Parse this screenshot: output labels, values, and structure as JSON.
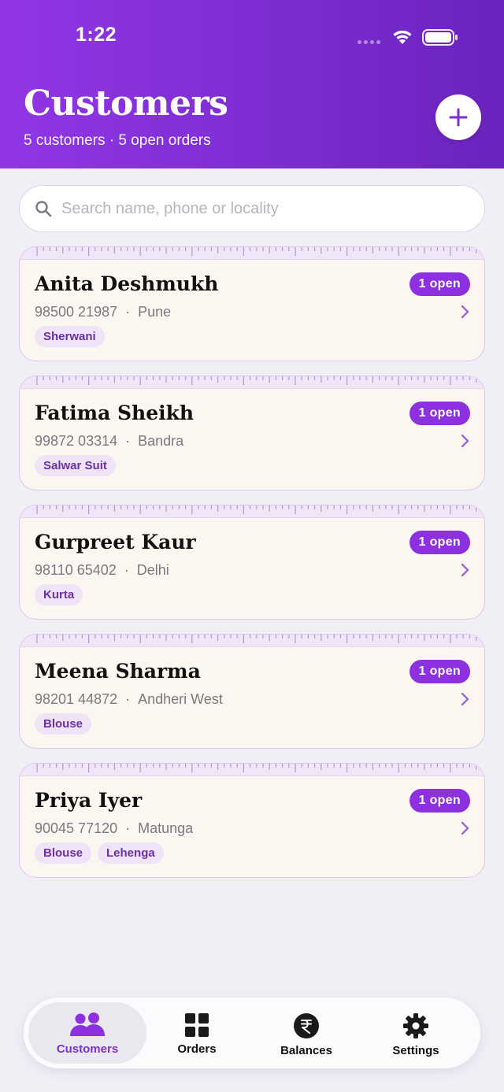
{
  "status_bar": {
    "time": "1:22"
  },
  "header": {
    "title": "Customers",
    "subtitle": "5 customers · 5 open orders",
    "add_icon": "plus-icon"
  },
  "search": {
    "placeholder": "Search name, phone or locality",
    "value": ""
  },
  "customers": [
    {
      "name": "Anita Deshmukh",
      "phone": "98500 21987",
      "locality": "Pune",
      "badge": "1 open",
      "tags": [
        "Sherwani"
      ]
    },
    {
      "name": "Fatima Sheikh",
      "phone": "99872 03314",
      "locality": "Bandra",
      "badge": "1 open",
      "tags": [
        "Salwar Suit"
      ]
    },
    {
      "name": "Gurpreet Kaur",
      "phone": "98110 65402",
      "locality": "Delhi",
      "badge": "1 open",
      "tags": [
        "Kurta"
      ]
    },
    {
      "name": "Meena Sharma",
      "phone": "98201 44872",
      "locality": "Andheri West",
      "badge": "1 open",
      "tags": [
        "Blouse"
      ]
    },
    {
      "name": "Priya Iyer",
      "phone": "90045 77120",
      "locality": "Matunga",
      "badge": "1 open",
      "tags": [
        "Blouse",
        "Lehenga"
      ]
    }
  ],
  "tabbar": {
    "tabs": [
      {
        "label": "Customers",
        "icon": "people-icon",
        "active": true
      },
      {
        "label": "Orders",
        "icon": "grid-icon",
        "active": false
      },
      {
        "label": "Balances",
        "icon": "rupee-icon",
        "active": false
      },
      {
        "label": "Settings",
        "icon": "gear-icon",
        "active": false
      }
    ]
  },
  "colors": {
    "accent": "#8c30e0",
    "header_gradient_start": "#9136e6",
    "header_gradient_end": "#6b23bd",
    "card_background": "#fbf7f0",
    "tag_background": "#efe3f8",
    "tag_text": "#6b2fa6"
  }
}
